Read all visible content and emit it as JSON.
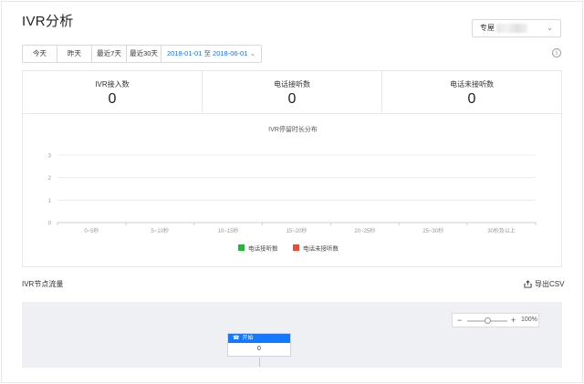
{
  "page_title": "IVR分析",
  "store_select": {
    "label": "专屋"
  },
  "filters": {
    "buttons": [
      "今天",
      "昨天",
      "最近7天",
      "最近30天"
    ],
    "date_range": "2018-01-01 至 2018-06-01"
  },
  "stats": [
    {
      "label": "IVR接入数",
      "value": "0"
    },
    {
      "label": "电话接听数",
      "value": "0"
    },
    {
      "label": "电话未接听数",
      "value": "0"
    }
  ],
  "chart_data": {
    "type": "bar",
    "title": "IVR停留时长分布",
    "categories": [
      "0~5秒",
      "5~10秒",
      "10~15秒",
      "15~20秒",
      "20~25秒",
      "25~30秒",
      "30秒及以上"
    ],
    "series": [
      {
        "name": "电话接听数",
        "values": [
          0,
          0,
          0,
          0,
          0,
          0,
          0
        ],
        "color": "#1aba3c"
      },
      {
        "name": "电话未接听数",
        "values": [
          0,
          0,
          0,
          0,
          0,
          0,
          0
        ],
        "color": "#f04b32"
      }
    ],
    "yticks": [
      "0",
      "1",
      "2",
      "3"
    ],
    "ylim": [
      0,
      3
    ],
    "legend": "bottom-center",
    "grid": true
  },
  "flow_section": {
    "title": "IVR节点流量",
    "export_label": "导出CSV"
  },
  "zoom": {
    "percent": "100%",
    "level": 0.5
  },
  "start_node": {
    "label": "开始",
    "count": "0"
  },
  "colors": {
    "accent": "#1677ff",
    "link": "#1a73e8"
  }
}
